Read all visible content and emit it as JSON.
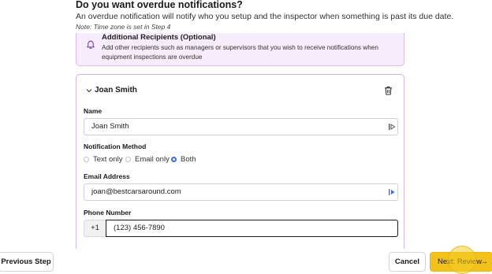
{
  "header": {
    "title": "Do you want overdue notifications?",
    "description": "An overdue notification will notify who you setup and the inspector when something is past its due date.",
    "note": "Note: Time zone is set in Step 4"
  },
  "recipients": {
    "title": "Additional Recipients (Optional)",
    "description": "Add other recipients such as managers or supervisors that you wish to receive notifications when equipment inspections are overdue",
    "icon": "bell-icon"
  },
  "contact": {
    "header_name": "Joan Smith",
    "name_label": "Name",
    "name_value": "Joan Smith",
    "method_label": "Notification Method",
    "methods": [
      {
        "label": "Text only",
        "selected": false
      },
      {
        "label": "Email only",
        "selected": false
      },
      {
        "label": "Both",
        "selected": true
      }
    ],
    "email_label": "Email Address",
    "email_value": "joan@bestcarsaround.com",
    "phone_label": "Phone Number",
    "phone_prefix": "+1",
    "phone_value": "(123) 456-7890"
  },
  "footer": {
    "prev_label": "Previous Step",
    "cancel_label": "Cancel",
    "next_label": "Next: Review",
    "next_arrow": "→"
  },
  "colors": {
    "accent_yellow": "#f2c21b",
    "radio_blue": "#3a6ee8",
    "card_purple": "#f6ecfb"
  }
}
